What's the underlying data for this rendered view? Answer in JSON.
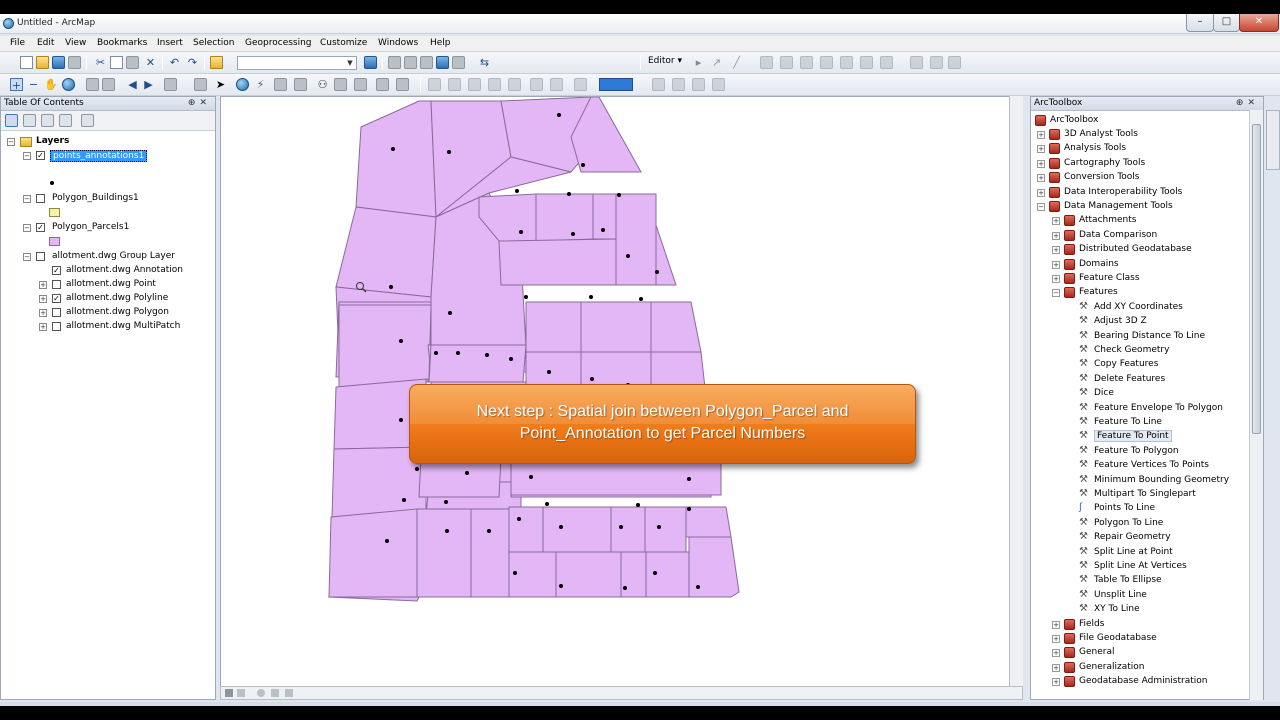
{
  "window": {
    "title": "Untitled - ArcMap",
    "min": "–",
    "max": "□",
    "close": "✕"
  },
  "menu": [
    "File",
    "Edit",
    "View",
    "Bookmarks",
    "Insert",
    "Selection",
    "Geoprocessing",
    "Customize",
    "Windows",
    "Help"
  ],
  "toolbar": {
    "editor_label": "Editor ▾",
    "scale_value": ""
  },
  "toc": {
    "title": "Table Of Contents",
    "rows": [
      {
        "label": "Layers",
        "indent": 0,
        "check": null,
        "exp": "−",
        "bold": true,
        "folder": true
      },
      {
        "label": "points_annotations1",
        "indent": 1,
        "check": true,
        "exp": "−",
        "selected": true
      },
      {
        "label": "Polygon_Buildings1",
        "indent": 1,
        "check": false,
        "exp": "−"
      },
      {
        "label": "Polygon_Parcels1",
        "indent": 1,
        "check": true,
        "exp": "−"
      },
      {
        "label": "allotment.dwg Group Layer",
        "indent": 1,
        "check": false,
        "exp": "−"
      },
      {
        "label": "allotment.dwg Annotation",
        "indent": 2,
        "check": true,
        "exp": null
      },
      {
        "label": "allotment.dwg Point",
        "indent": 2,
        "check": false,
        "exp": "+"
      },
      {
        "label": "allotment.dwg Polyline",
        "indent": 2,
        "check": true,
        "exp": "+"
      },
      {
        "label": "allotment.dwg Polygon",
        "indent": 2,
        "check": false,
        "exp": "+"
      },
      {
        "label": "allotment.dwg MultiPatch",
        "indent": 2,
        "check": false,
        "exp": "+"
      }
    ],
    "colors": {
      "buildings": "#f3f3a8",
      "parcels": "#e3b7f5"
    }
  },
  "callout": {
    "line1": "Next step : Spatial join between Polygon_Parcel and",
    "line2": "Point_Annotation to get Parcel Numbers",
    "color": "#ef7a18"
  },
  "map": {
    "parcel_fill": "#e3b7f5",
    "parcel_stroke": "#8a6a9a",
    "point_color": "#000000"
  },
  "toolbox": {
    "title": "ArcToolbox",
    "root": "ArcToolbox",
    "items": [
      {
        "label": "3D Analyst Tools",
        "level": 1,
        "type": "box",
        "exp": "+"
      },
      {
        "label": "Analysis Tools",
        "level": 1,
        "type": "box",
        "exp": "+"
      },
      {
        "label": "Cartography Tools",
        "level": 1,
        "type": "box",
        "exp": "+"
      },
      {
        "label": "Conversion Tools",
        "level": 1,
        "type": "box",
        "exp": "+"
      },
      {
        "label": "Data Interoperability Tools",
        "level": 1,
        "type": "box",
        "exp": "+"
      },
      {
        "label": "Data Management Tools",
        "level": 1,
        "type": "box",
        "exp": "−"
      },
      {
        "label": "Attachments",
        "level": 2,
        "type": "box",
        "exp": "+"
      },
      {
        "label": "Data Comparison",
        "level": 2,
        "type": "box",
        "exp": "+"
      },
      {
        "label": "Distributed Geodatabase",
        "level": 2,
        "type": "box",
        "exp": "+"
      },
      {
        "label": "Domains",
        "level": 2,
        "type": "box",
        "exp": "+"
      },
      {
        "label": "Feature Class",
        "level": 2,
        "type": "box",
        "exp": "+"
      },
      {
        "label": "Features",
        "level": 2,
        "type": "box",
        "exp": "−"
      },
      {
        "label": "Add XY Coordinates",
        "level": 3,
        "type": "tool"
      },
      {
        "label": "Adjust 3D Z",
        "level": 3,
        "type": "tool"
      },
      {
        "label": "Bearing Distance To Line",
        "level": 3,
        "type": "tool"
      },
      {
        "label": "Check Geometry",
        "level": 3,
        "type": "tool"
      },
      {
        "label": "Copy Features",
        "level": 3,
        "type": "tool"
      },
      {
        "label": "Delete Features",
        "level": 3,
        "type": "tool"
      },
      {
        "label": "Dice",
        "level": 3,
        "type": "tool"
      },
      {
        "label": "Feature Envelope To Polygon",
        "level": 3,
        "type": "tool"
      },
      {
        "label": "Feature To Line",
        "level": 3,
        "type": "tool"
      },
      {
        "label": "Feature To Point",
        "level": 3,
        "type": "tool",
        "highlight": true
      },
      {
        "label": "Feature To Polygon",
        "level": 3,
        "type": "tool"
      },
      {
        "label": "Feature Vertices To Points",
        "level": 3,
        "type": "tool"
      },
      {
        "label": "Minimum Bounding Geometry",
        "level": 3,
        "type": "tool"
      },
      {
        "label": "Multipart To Singlepart",
        "level": 3,
        "type": "tool"
      },
      {
        "label": "Points To Line",
        "level": 3,
        "type": "script"
      },
      {
        "label": "Polygon To Line",
        "level": 3,
        "type": "tool"
      },
      {
        "label": "Repair Geometry",
        "level": 3,
        "type": "tool"
      },
      {
        "label": "Split Line at Point",
        "level": 3,
        "type": "tool"
      },
      {
        "label": "Split Line At Vertices",
        "level": 3,
        "type": "tool"
      },
      {
        "label": "Table To Ellipse",
        "level": 3,
        "type": "tool"
      },
      {
        "label": "Unsplit Line",
        "level": 3,
        "type": "tool"
      },
      {
        "label": "XY To Line",
        "level": 3,
        "type": "tool"
      },
      {
        "label": "Fields",
        "level": 2,
        "type": "box",
        "exp": "+"
      },
      {
        "label": "File Geodatabase",
        "level": 2,
        "type": "box",
        "exp": "+"
      },
      {
        "label": "General",
        "level": 2,
        "type": "box",
        "exp": "+"
      },
      {
        "label": "Generalization",
        "level": 2,
        "type": "box",
        "exp": "+"
      },
      {
        "label": "Geodatabase Administration",
        "level": 2,
        "type": "box",
        "exp": "+"
      }
    ]
  }
}
